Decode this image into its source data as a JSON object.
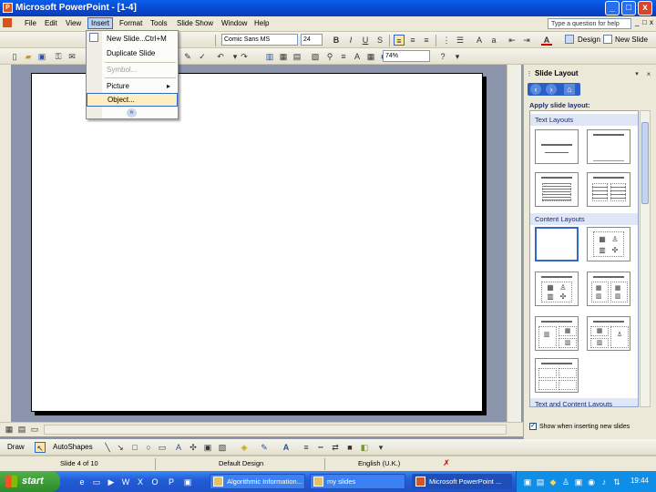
{
  "window": {
    "title": "Microsoft PowerPoint - [1-4]",
    "controls": [
      "_",
      "□",
      "x"
    ],
    "doc_controls": [
      "_",
      "□",
      "x"
    ]
  },
  "menubar": {
    "items": [
      "File",
      "Edit",
      "View",
      "Insert",
      "Format",
      "Tools",
      "Slide Show",
      "Window",
      "Help"
    ],
    "help_placeholder": "Type a question for help"
  },
  "toolbar": {
    "font_name": "Comic Sans MS",
    "font_size": "24",
    "bold": "B",
    "italic": "I",
    "underline": "U",
    "shadow": "S",
    "font_color_label": "A",
    "design_label": "Design",
    "new_slide_label": "New Slide",
    "zoom": "74%"
  },
  "insert_menu": {
    "items": [
      {
        "label": "New Slide...",
        "shortcut": "Ctrl+M",
        "enabled": true
      },
      {
        "label": "Duplicate Slide",
        "shortcut": "",
        "enabled": true
      },
      {
        "label": "Symbol...",
        "shortcut": "",
        "enabled": false
      },
      {
        "label": "Picture",
        "shortcut": "▸",
        "enabled": true
      },
      {
        "label": "Object...",
        "shortcut": "",
        "enabled": true,
        "highlighted": true
      }
    ],
    "expand_icon": "chevron-double-down-icon"
  },
  "task_pane": {
    "title": "Slide Layout",
    "apply_label": "Apply slide layout:",
    "sections": [
      "Text Layouts",
      "Content Layouts",
      "Text and Content Layouts"
    ],
    "show_when_inserting": "Show when inserting new slides",
    "show_checked": "✓"
  },
  "drawing_toolbar": {
    "draw_label": "Draw",
    "autoshapes_label": "AutoShapes"
  },
  "statusbar": {
    "slide": "Slide 4 of 10",
    "design": "Default Design",
    "language": "English (U.K.)"
  },
  "taskbar": {
    "start_label": "start",
    "tasks": [
      {
        "label": "Algorithmic Information...",
        "active": false
      },
      {
        "label": "my slides",
        "active": false
      },
      {
        "label": "Microsoft PowerPoint ...",
        "active": true
      }
    ],
    "clock": "19:44"
  },
  "colors": {
    "title_bar": "#0a5ee8",
    "menu_highlight": "#ffeec2",
    "selection_border": "#316ac5",
    "taskbar": "#225ed8",
    "start_green": "#3c9a36"
  }
}
